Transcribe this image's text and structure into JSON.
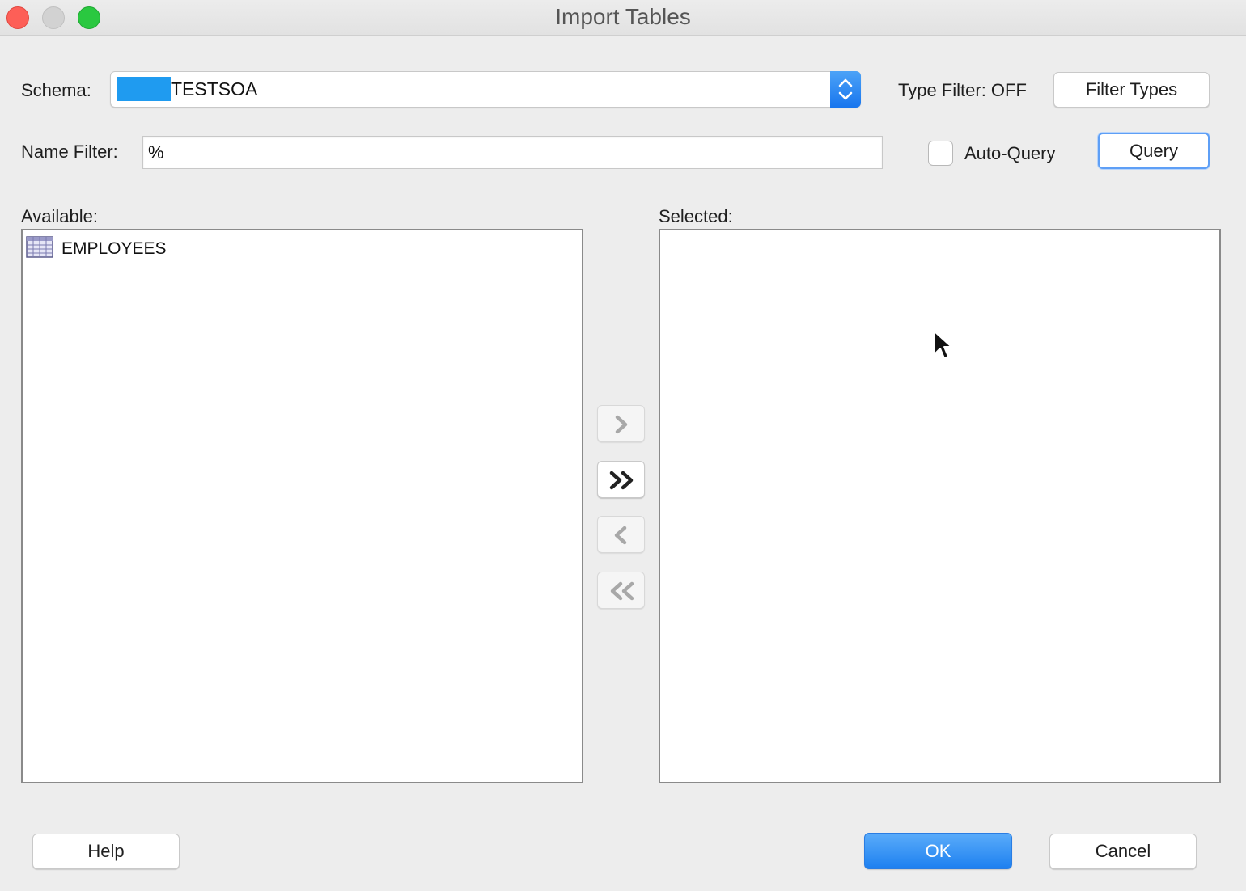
{
  "window": {
    "title": "Import Tables"
  },
  "schema": {
    "label": "Schema:",
    "value": "TESTSOA"
  },
  "type_filter": {
    "status_text": "Type Filter: OFF",
    "button_label": "Filter Types"
  },
  "name_filter": {
    "label": "Name Filter:",
    "value": "%"
  },
  "auto_query": {
    "label": "Auto-Query",
    "checked": false
  },
  "query_button": {
    "label": "Query"
  },
  "available": {
    "label": "Available:",
    "items": [
      {
        "label": "EMPLOYEES",
        "icon": "table-icon"
      }
    ]
  },
  "selected": {
    "label": "Selected:",
    "items": []
  },
  "move_buttons": [
    {
      "name": "move-selected-right",
      "icon": "chevron-right-icon",
      "enabled": false
    },
    {
      "name": "move-all-right",
      "icon": "double-chevron-right-icon",
      "enabled": true
    },
    {
      "name": "move-selected-left",
      "icon": "chevron-left-icon",
      "enabled": false
    },
    {
      "name": "move-all-left",
      "icon": "double-chevron-left-icon",
      "enabled": false
    }
  ],
  "footer": {
    "help_label": "Help",
    "ok_label": "OK",
    "cancel_label": "Cancel"
  },
  "colors": {
    "accent": "#1f80f0",
    "redaction": "#1f9bf0"
  }
}
